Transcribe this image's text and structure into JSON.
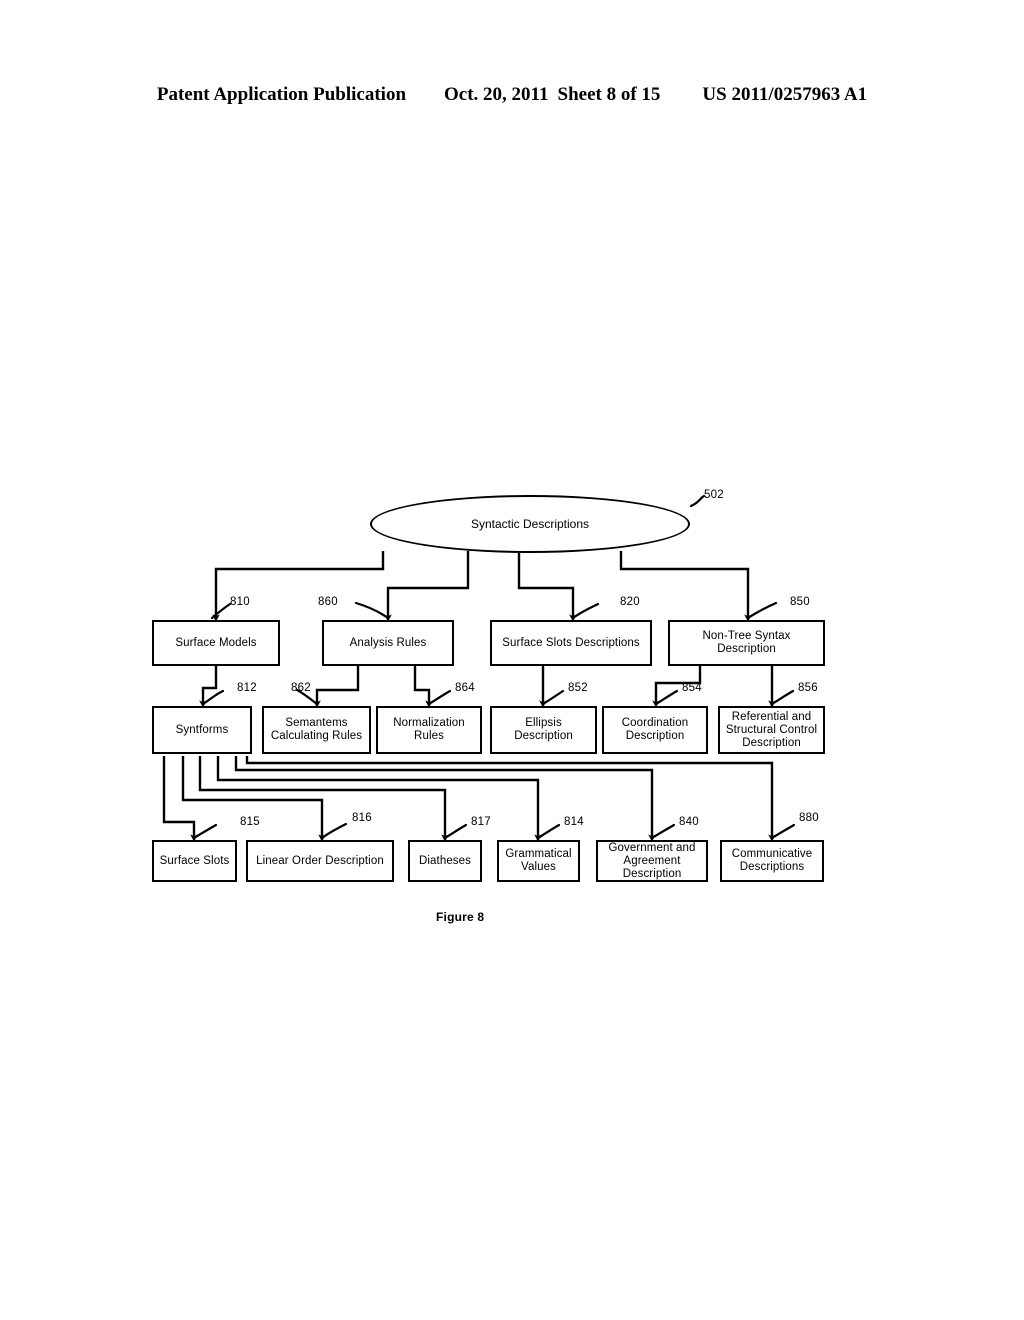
{
  "header": {
    "publication": "Patent Application Publication",
    "date": "Oct. 20, 2011",
    "sheet": "Sheet 8 of 15",
    "doc_number": "US 2011/0257963 A1"
  },
  "figure": {
    "caption": "Figure 8",
    "root": {
      "label": "Syntactic Descriptions",
      "ref": "502"
    },
    "nodes": [
      {
        "id": "surface-models",
        "label": "Surface Models",
        "ref": "810"
      },
      {
        "id": "analysis-rules",
        "label": "Analysis Rules",
        "ref": "860"
      },
      {
        "id": "surface-slots-desc",
        "label": "Surface Slots Descriptions",
        "ref": "820"
      },
      {
        "id": "non-tree-syntax",
        "label": "Non-Tree Syntax Description",
        "ref": "850"
      },
      {
        "id": "syntforms",
        "label": "Syntforms",
        "ref": "812"
      },
      {
        "id": "semantems-rules",
        "label": "Semantems Calculating Rules",
        "ref": "862"
      },
      {
        "id": "normalization-rules",
        "label": "Normalization Rules",
        "ref": "864"
      },
      {
        "id": "ellipsis-desc",
        "label": "Ellipsis Description",
        "ref": "852"
      },
      {
        "id": "coordination-desc",
        "label": "Coordination Description",
        "ref": "854"
      },
      {
        "id": "referential-desc",
        "label": "Referential and Structural Control Description",
        "ref": "856"
      },
      {
        "id": "surface-slots",
        "label": "Surface Slots",
        "ref": "815"
      },
      {
        "id": "linear-order-desc",
        "label": "Linear Order Description",
        "ref": "816"
      },
      {
        "id": "diatheses",
        "label": "Diatheses",
        "ref": "817"
      },
      {
        "id": "grammatical-values",
        "label": "Grammatical Values",
        "ref": "814"
      },
      {
        "id": "government-agreement",
        "label": "Government and Agreement Description",
        "ref": "840"
      },
      {
        "id": "communicative-desc",
        "label": "Communicative Descriptions",
        "ref": "880"
      }
    ]
  },
  "colors": {
    "ink": "#000000",
    "paper": "#ffffff"
  }
}
